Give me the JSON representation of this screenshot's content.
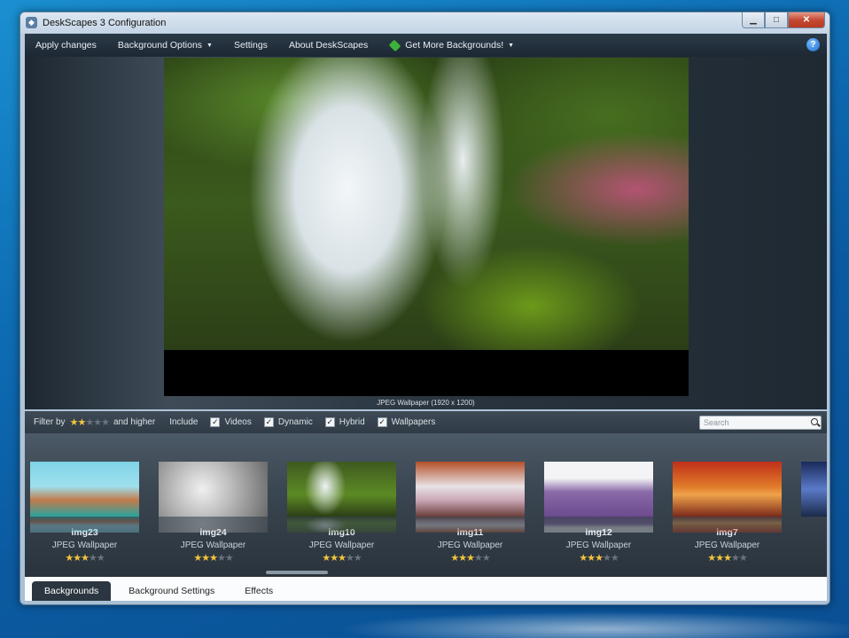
{
  "window": {
    "title": "DeskScapes 3 Configuration"
  },
  "menu": {
    "apply": "Apply changes",
    "background_options": "Background Options",
    "settings": "Settings",
    "about": "About DeskScapes",
    "get_more": "Get More Backgrounds!"
  },
  "preview": {
    "caption": "JPEG Wallpaper (1920 x 1200)"
  },
  "filter": {
    "filter_by": "Filter by",
    "rating_stars": 2,
    "and_higher": "and higher",
    "include": "Include",
    "options": [
      {
        "label": "Videos",
        "checked": true
      },
      {
        "label": "Dynamic",
        "checked": true
      },
      {
        "label": "Hybrid",
        "checked": true
      },
      {
        "label": "Wallpapers",
        "checked": true
      }
    ],
    "search_placeholder": "Search"
  },
  "gallery": {
    "items": [
      {
        "name": "img23",
        "type": "JPEG Wallpaper",
        "rating": 3
      },
      {
        "name": "img24",
        "type": "JPEG Wallpaper",
        "rating": 3
      },
      {
        "name": "img10",
        "type": "JPEG Wallpaper",
        "rating": 3
      },
      {
        "name": "img11",
        "type": "JPEG Wallpaper",
        "rating": 3
      },
      {
        "name": "img12",
        "type": "JPEG Wallpaper",
        "rating": 3
      },
      {
        "name": "img7",
        "type": "JPEG Wallpaper",
        "rating": 3
      }
    ]
  },
  "tabs": [
    "Backgrounds",
    "Background Settings",
    "Effects"
  ],
  "colors": {
    "accent_star": "#f2c53d",
    "menubar": "#1d2833"
  }
}
